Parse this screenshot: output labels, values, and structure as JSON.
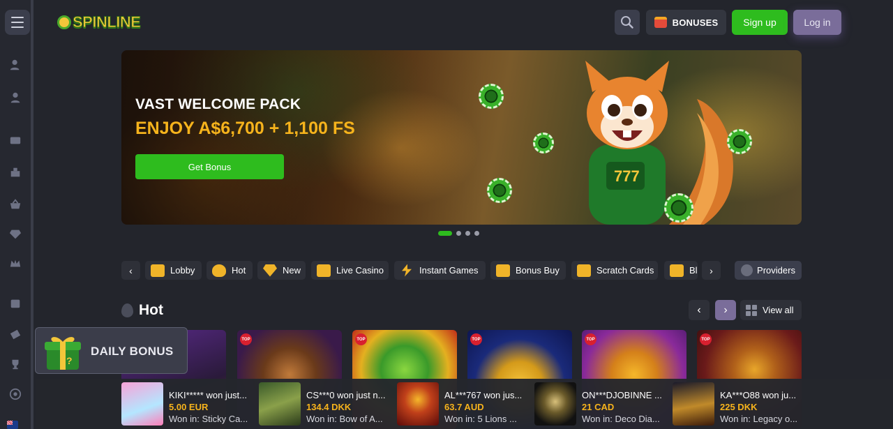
{
  "brand": {
    "name": "SPINLINE"
  },
  "header": {
    "bonuses_label": "BONUSES",
    "signup_label": "Sign up",
    "login_label": "Log in"
  },
  "banner": {
    "title": "VAST WELCOME PACK",
    "subtitle": "ENJOY A$6,700 + 1,100 FS",
    "cta_label": "Get Bonus",
    "slides": 4,
    "active_slide": 1
  },
  "categories": {
    "items": [
      {
        "label": "Lobby",
        "icon": "slot-777-icon"
      },
      {
        "label": "Hot",
        "icon": "flame-icon"
      },
      {
        "label": "New",
        "icon": "diamond-icon"
      },
      {
        "label": "Live Casino",
        "icon": "live-camera-icon"
      },
      {
        "label": "Instant Games",
        "icon": "lightning-icon"
      },
      {
        "label": "Bonus Buy",
        "icon": "treasure-chest-icon"
      },
      {
        "label": "Scratch Cards",
        "icon": "scratch-card-icon"
      },
      {
        "label": "Bl",
        "icon": "cards-icon"
      }
    ],
    "providers_label": "Providers"
  },
  "hot_section": {
    "title": "Hot",
    "view_all_label": "View all",
    "badge_label": "TOP"
  },
  "daily_bonus": {
    "label": "DAILY BONUS"
  },
  "recent_wins": [
    {
      "user": "KIKI***** won just...",
      "amount": "5.00 EUR",
      "game": "Won in: Sticky Ca..."
    },
    {
      "user": "CS***0 won just n...",
      "amount": "134.4 DKK",
      "game": "Won in: Bow of A..."
    },
    {
      "user": "AL***767 won jus...",
      "amount": "63.7 AUD",
      "game": "Won in: 5 Lions ..."
    },
    {
      "user": "ON***DJOBINNE ...",
      "amount": "21 CAD",
      "game": "Won in: Deco Dia..."
    },
    {
      "user": "KA***O88 won ju...",
      "amount": "225 DKK",
      "game": "Won in: Legacy o..."
    }
  ],
  "colors": {
    "accent_green": "#2ebc1e",
    "accent_gold": "#f6b31c",
    "login_purple": "#7a6d9a",
    "background": "#23252c"
  }
}
